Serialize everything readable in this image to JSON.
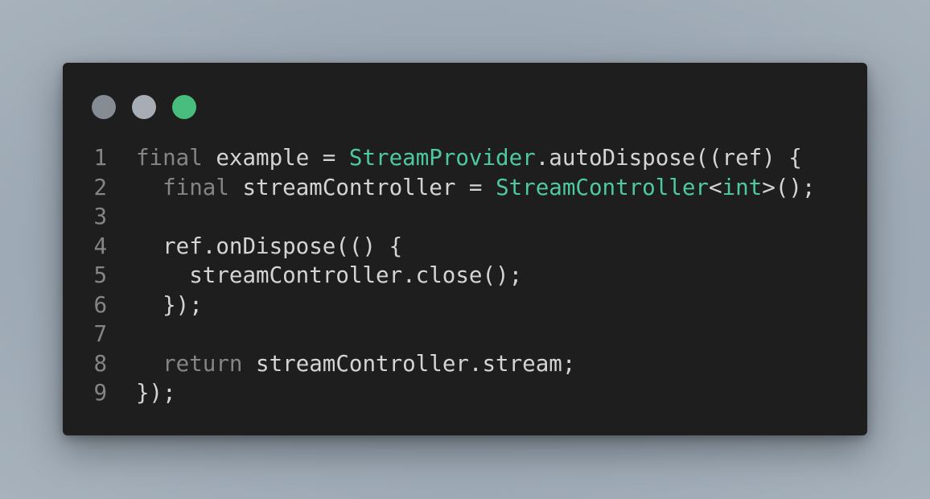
{
  "colors": {
    "keyword": "#858585",
    "type": "#4ec9a0",
    "plain": "#d4d4d4",
    "line_number": "#858585",
    "dot_1": "#858c94",
    "dot_2": "#a6adb4",
    "dot_3": "#48bd7d"
  },
  "window_controls": [
    {
      "icon": "circle-dot-icon",
      "color": "#858c94"
    },
    {
      "icon": "circle-dot-icon",
      "color": "#a6adb4"
    },
    {
      "icon": "circle-dot-icon",
      "color": "#48bd7d"
    }
  ],
  "code": {
    "lines": [
      {
        "number": "1",
        "tokens": [
          {
            "text": "final",
            "kind": "keyword"
          },
          {
            "text": " example = ",
            "kind": "plain"
          },
          {
            "text": "StreamProvider",
            "kind": "type"
          },
          {
            "text": ".autoDispose((ref) {",
            "kind": "plain"
          }
        ]
      },
      {
        "number": "2",
        "tokens": [
          {
            "text": "  ",
            "kind": "plain"
          },
          {
            "text": "final",
            "kind": "keyword"
          },
          {
            "text": " streamController = ",
            "kind": "plain"
          },
          {
            "text": "StreamController",
            "kind": "type"
          },
          {
            "text": "<",
            "kind": "plain"
          },
          {
            "text": "int",
            "kind": "type"
          },
          {
            "text": ">();",
            "kind": "plain"
          }
        ]
      },
      {
        "number": "3",
        "tokens": []
      },
      {
        "number": "4",
        "tokens": [
          {
            "text": "  ref.onDispose(() {",
            "kind": "plain"
          }
        ]
      },
      {
        "number": "5",
        "tokens": [
          {
            "text": "    streamController.close();",
            "kind": "plain"
          }
        ]
      },
      {
        "number": "6",
        "tokens": [
          {
            "text": "  });",
            "kind": "plain"
          }
        ]
      },
      {
        "number": "7",
        "tokens": []
      },
      {
        "number": "8",
        "tokens": [
          {
            "text": "  ",
            "kind": "plain"
          },
          {
            "text": "return",
            "kind": "keyword"
          },
          {
            "text": " streamController.stream;",
            "kind": "plain"
          }
        ]
      },
      {
        "number": "9",
        "tokens": [
          {
            "text": "});",
            "kind": "plain"
          }
        ]
      }
    ]
  }
}
